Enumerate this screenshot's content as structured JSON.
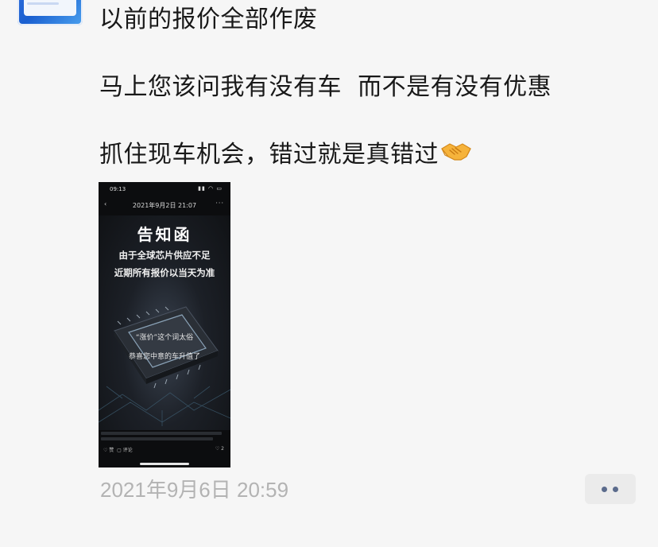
{
  "post": {
    "lines": [
      "以前的报价全部作废",
      "马上您该问我有没有车  而不是有没有优惠",
      "抓住现车机会，错过就是真错过"
    ],
    "emoji": "handshake-emoji",
    "timestamp": "2021年9月6日 20:59"
  },
  "image": {
    "status_time": "09:13",
    "status_icons": "signal wifi battery",
    "nav_back": "‹",
    "nav_date": "2021年9月2日 21:07",
    "nav_more": "···",
    "title": "告知函",
    "subtitle_1": "由于全球芯片供应不足",
    "subtitle_2": "近期所有报价以当天为准",
    "caption_1": "“涨价”这个词太俗",
    "caption_2": "恭喜您中意的车升值了",
    "like_text": "赞",
    "comment_text": "评论",
    "right_count": "2"
  },
  "colors": {
    "accent": "#5b6b8c",
    "background": "#f6f6f6",
    "timestamp": "#b3b3b3"
  }
}
